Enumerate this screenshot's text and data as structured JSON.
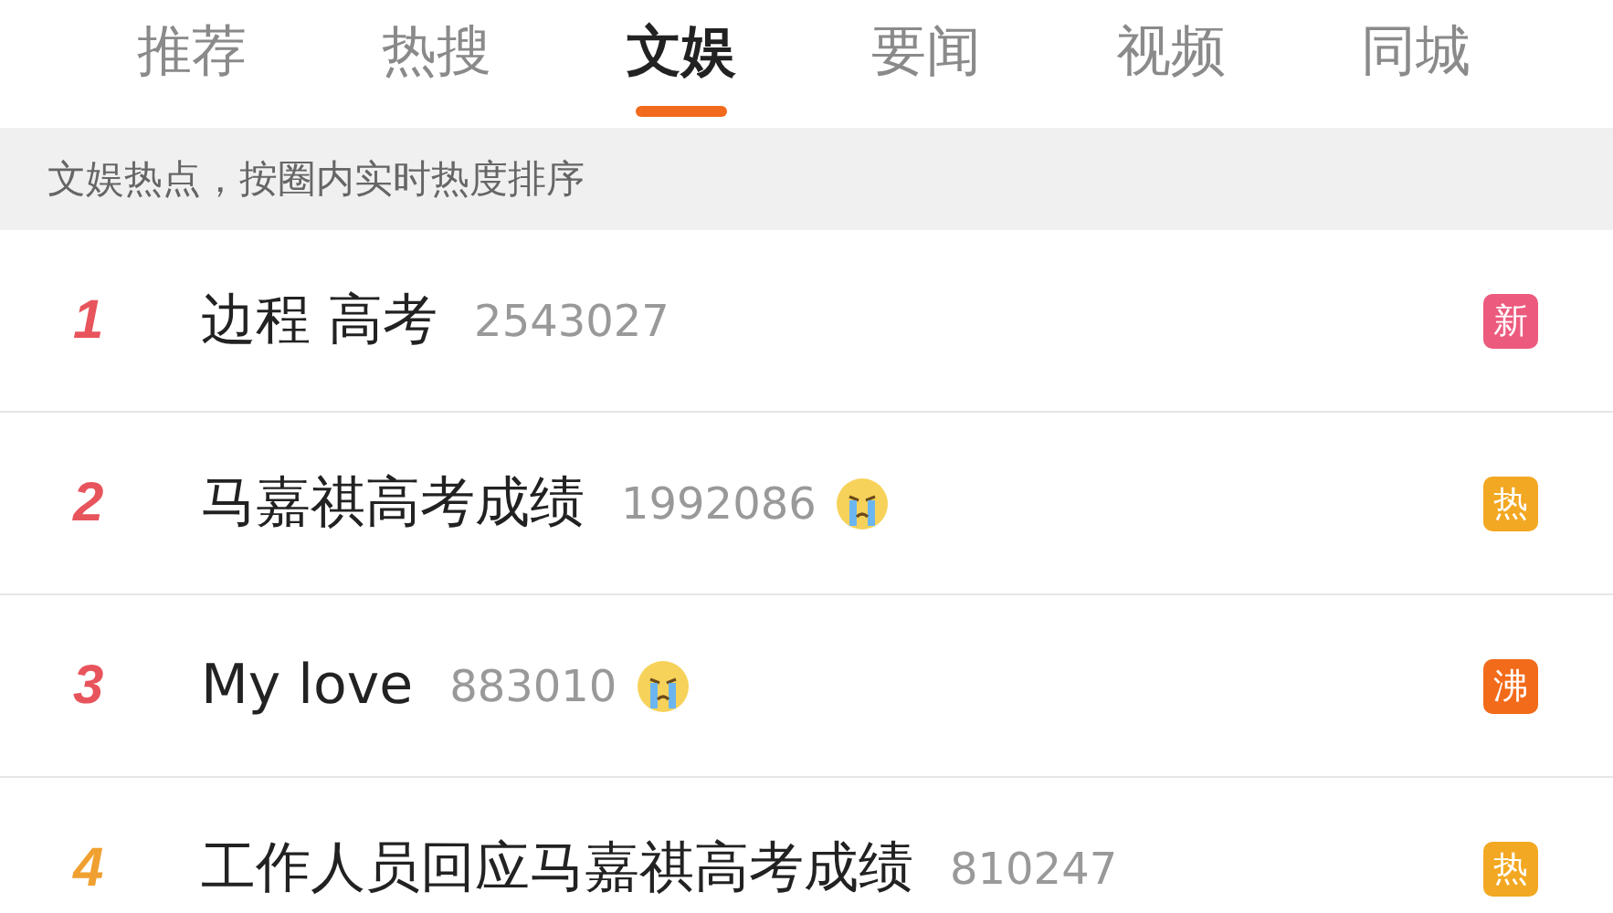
{
  "tabs": [
    {
      "label": "推荐",
      "selected": false
    },
    {
      "label": "热搜",
      "selected": false
    },
    {
      "label": "文娱",
      "selected": true
    },
    {
      "label": "要闻",
      "selected": false
    },
    {
      "label": "视频",
      "selected": false
    },
    {
      "label": "同城",
      "selected": false
    }
  ],
  "notice": "文娱热点，按圈内实时热度排序",
  "items": [
    {
      "rank": "1",
      "color": "#e8545c",
      "title": "边程 高考",
      "count": "2543027",
      "crying_emoji": false,
      "badge": {
        "kind": "new",
        "label": "新"
      }
    },
    {
      "rank": "2",
      "color": "#e8545c",
      "title": "马嘉祺高考成绩",
      "count": "1992086",
      "crying_emoji": true,
      "badge": {
        "kind": "hot",
        "label": "热"
      }
    },
    {
      "rank": "3",
      "color": "#e8545c",
      "title": "My love",
      "count": "883010",
      "crying_emoji": true,
      "badge": {
        "kind": "boil",
        "label": "沸"
      }
    },
    {
      "rank": "4",
      "color": "#f0a030",
      "title": "工作人员回应马嘉祺高考成绩",
      "count": "810247",
      "crying_emoji": false,
      "badge": {
        "kind": "hot",
        "label": "热"
      }
    }
  ]
}
